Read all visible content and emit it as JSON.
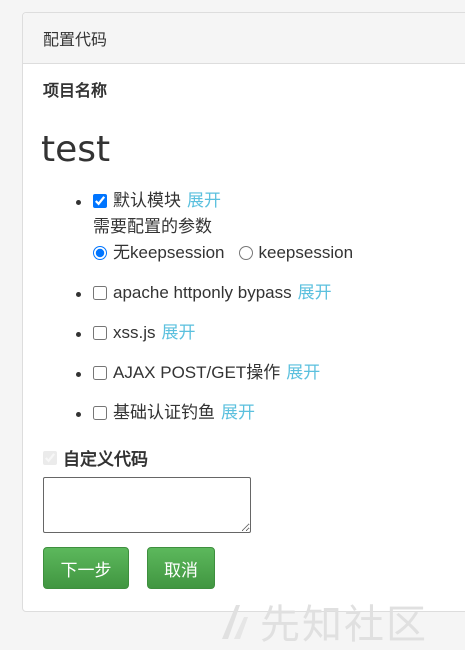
{
  "panel": {
    "title": "配置代码"
  },
  "project": {
    "label": "项目名称",
    "name": "test"
  },
  "modules": [
    {
      "label": "默认模块",
      "checked": true,
      "expand": "展开"
    },
    {
      "label": "apache httponly bypass",
      "checked": false,
      "expand": "展开"
    },
    {
      "label": "xss.js",
      "checked": false,
      "expand": "展开"
    },
    {
      "label": "AJAX POST/GET操作",
      "checked": false,
      "expand": "展开"
    },
    {
      "label": "基础认证钓鱼",
      "checked": false,
      "expand": "展开"
    }
  ],
  "params": {
    "title": "需要配置的参数",
    "options": [
      "无keepsession",
      "keepsession"
    ],
    "selected": "无keepsession"
  },
  "custom_code": {
    "label": "自定义代码",
    "checked": true,
    "disabled": true,
    "value": ""
  },
  "buttons": {
    "next": "下一步",
    "cancel": "取消"
  },
  "watermark": {
    "text": "先知社区"
  },
  "colors": {
    "accent_link": "#5bc0de",
    "button_green": "#5cb85c"
  }
}
